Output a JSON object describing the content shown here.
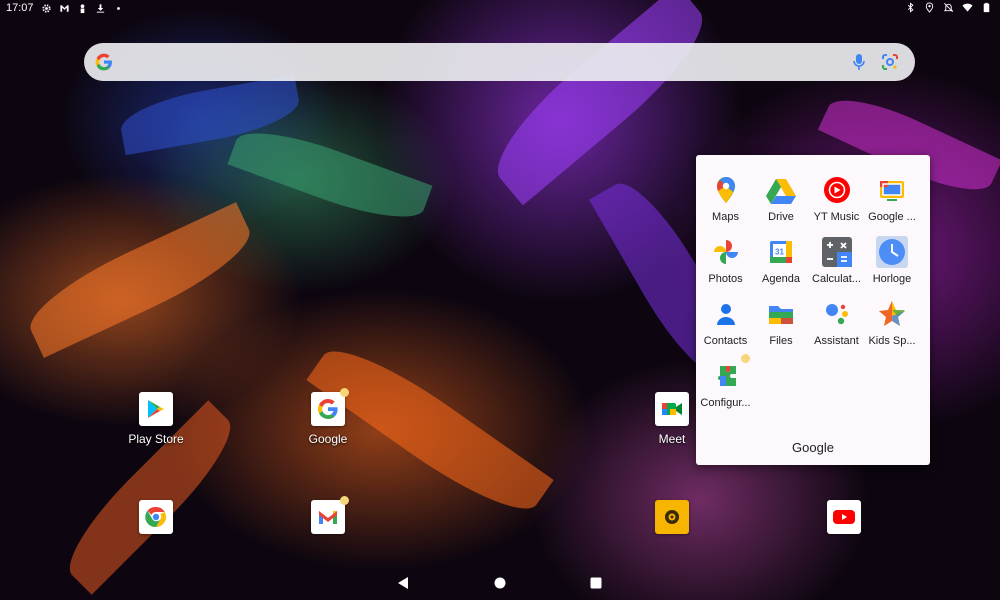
{
  "status_bar": {
    "time": "17:07",
    "left_icons": [
      "settings-icon",
      "gmail-notification-icon",
      "person-icon",
      "download-icon",
      "more-dot-icon"
    ],
    "right_icons": [
      "bluetooth-icon",
      "location-icon",
      "do-not-disturb-icon",
      "wifi-icon",
      "battery-icon"
    ]
  },
  "search_bar": {
    "logo": "google-g-icon",
    "mic": "microphone-icon",
    "lens": "google-lens-icon"
  },
  "desktop": {
    "row1": [
      {
        "label": "Play Store",
        "icon": "play-store-icon"
      },
      {
        "label": "Google",
        "icon": "google-icon",
        "badge": true
      },
      {
        "label": "Meet",
        "icon": "meet-icon"
      }
    ],
    "dock": [
      {
        "icon": "chrome-icon"
      },
      {
        "icon": "gmail-icon",
        "badge": true
      },
      {
        "icon": "camera-app-icon"
      },
      {
        "icon": "youtube-icon"
      }
    ]
  },
  "folder": {
    "title": "Google",
    "apps": [
      {
        "label": "Maps",
        "icon": "maps-icon"
      },
      {
        "label": "Drive",
        "icon": "drive-icon"
      },
      {
        "label": "YT Music",
        "icon": "yt-music-icon"
      },
      {
        "label": "Google ...",
        "icon": "google-tv-icon"
      },
      {
        "label": "Photos",
        "icon": "photos-icon"
      },
      {
        "label": "Agenda",
        "icon": "calendar-icon"
      },
      {
        "label": "Calculat...",
        "icon": "calculator-icon"
      },
      {
        "label": "Horloge",
        "icon": "clock-icon"
      },
      {
        "label": "Contacts",
        "icon": "contacts-icon"
      },
      {
        "label": "Files",
        "icon": "files-icon"
      },
      {
        "label": "Assistant",
        "icon": "assistant-icon"
      },
      {
        "label": "Kids Sp...",
        "icon": "kids-space-icon"
      },
      {
        "label": "Configur...",
        "icon": "configurator-icon",
        "badge": true
      }
    ]
  },
  "nav_bar": {
    "back": "back-icon",
    "home": "home-icon",
    "recents": "recents-icon"
  },
  "colors": {
    "badge": "#f6d67a",
    "google_blue": "#4285F4",
    "google_red": "#EA4335",
    "google_yellow": "#FBBC05",
    "google_green": "#34A853"
  }
}
